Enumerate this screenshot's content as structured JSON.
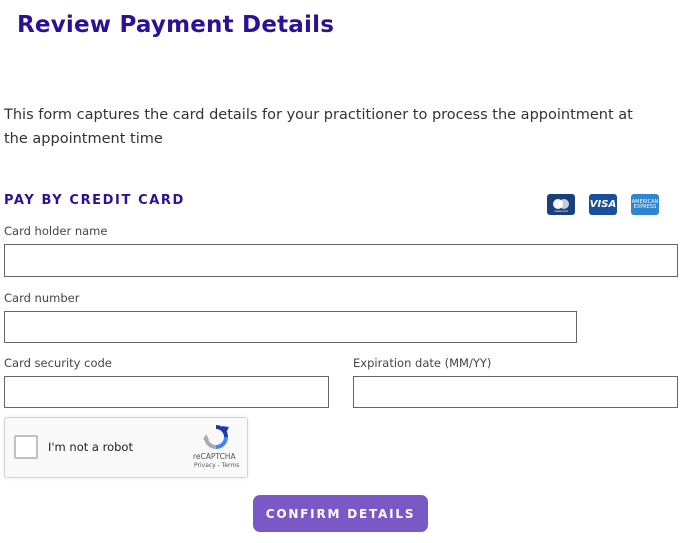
{
  "page": {
    "title": "Review Payment Details"
  },
  "description": "This form captures the card details for your practitioner to process the appointment at the appointment time",
  "section": {
    "title": "PAY BY CREDIT CARD"
  },
  "card_logos": {
    "mastercard_text": "mastercard",
    "visa_text": "VISA",
    "amex_line1": "AMERICAN",
    "amex_line2": "EXPRESS"
  },
  "fields": {
    "holder_label": "Card holder name",
    "number_label": "Card number",
    "cvc_label": "Card security code",
    "expiry_label": "Expiration date (MM/YY)"
  },
  "captcha": {
    "label": "I'm not a robot",
    "brand": "reCAPTCHA",
    "links": "Privacy - Terms"
  },
  "confirm_button": {
    "label": "CONFIRM DETAILS"
  },
  "colors": {
    "title": "#2a1296",
    "button": "#7a58c6"
  }
}
